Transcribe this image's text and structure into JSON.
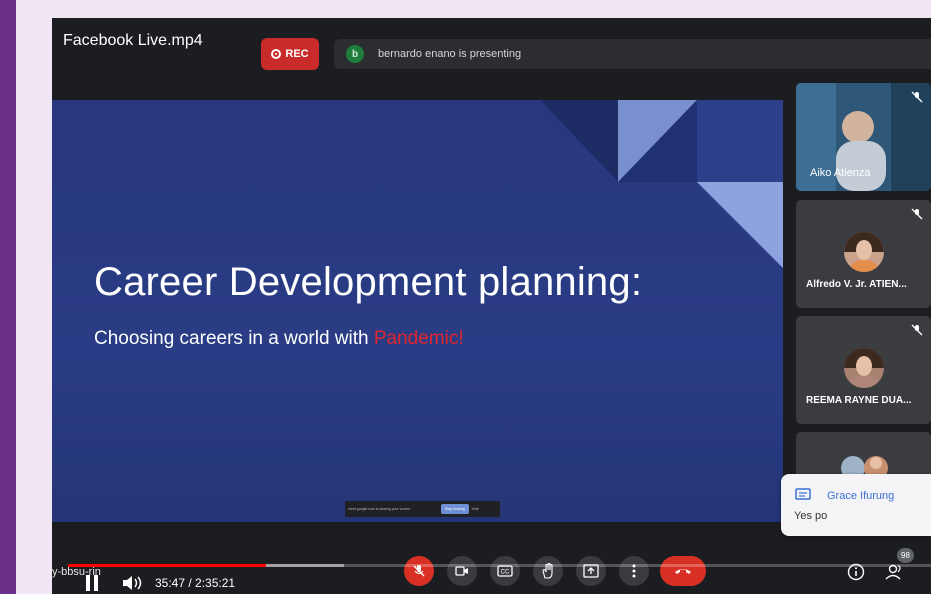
{
  "window": {
    "title": "Facebook Live.mp4"
  },
  "recording": {
    "label": "REC"
  },
  "presenting": {
    "avatar_letter": "b",
    "text": "bernardo enano is presenting"
  },
  "slide": {
    "heading": "Career Development planning:",
    "subtitle_main": "Choosing careers in a world with ",
    "subtitle_highlight": "Pandemic!",
    "highlight_color": "#e0262c",
    "share_bar": {
      "text": "meet.google.com is sharing your screen.",
      "stop_label": "Stop sharing",
      "hide_label": "Hide"
    }
  },
  "participants": [
    {
      "name": "Aiko Atienza",
      "muted": true
    },
    {
      "name": "Alfredo V. Jr. ATIEN...",
      "muted": true
    },
    {
      "name": "REEMA RAYNE DUA...",
      "muted": true
    },
    {
      "name": "",
      "muted": false
    }
  ],
  "chat": {
    "sender": "Grace Ifurung",
    "message": "Yes po"
  },
  "player": {
    "code": "y-bbsu-rin",
    "time": "35:47 / 2:35:21",
    "progress": 0.2298,
    "buffered": 0.32
  },
  "meet_controls": [
    {
      "name": "mic-off-icon",
      "active_red": true
    },
    {
      "name": "camera-icon",
      "active_red": false
    },
    {
      "name": "captions-icon",
      "active_red": false
    },
    {
      "name": "raise-hand-icon",
      "active_red": false
    },
    {
      "name": "present-icon",
      "active_red": false
    },
    {
      "name": "more-options-icon",
      "active_red": false
    },
    {
      "name": "end-call-icon",
      "active_red": true
    }
  ],
  "people_count": "98",
  "colors": {
    "accent": "#3b6fd6",
    "danger": "#d93025",
    "slide_bg": "#2a3c85",
    "brand_band": "#6a2f86"
  }
}
